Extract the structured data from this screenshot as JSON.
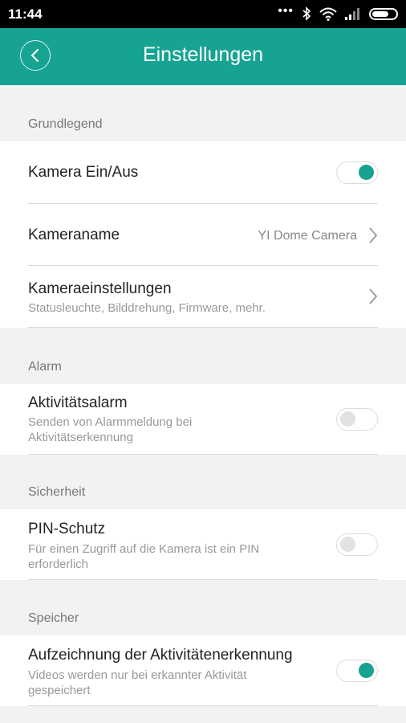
{
  "status_bar": {
    "time": "11:44",
    "icons": [
      "more-dots-icon",
      "bluetooth-icon",
      "wifi-icon",
      "signal-icon",
      "battery-icon"
    ]
  },
  "header": {
    "title": "Einstellungen",
    "back_icon": "chevron-left-icon",
    "color": "#16a392"
  },
  "sections": [
    {
      "label": "Grundlegend",
      "items": [
        {
          "title": "Kamera Ein/Aus",
          "toggle": true
        },
        {
          "title": "Kameraname",
          "value": "YI Dome Camera",
          "icon": "chevron-right-icon"
        },
        {
          "title": "Kameraeinstellungen",
          "subtitle": "Statusleuchte, Bilddrehung, Firmware, mehr.",
          "icon": "chevron-right-icon"
        }
      ]
    },
    {
      "label": "Alarm",
      "items": [
        {
          "title": "Aktivitätsalarm",
          "subtitle": "Senden von Alarmmeldung bei Aktivitätserkennung",
          "toggle": false
        }
      ]
    },
    {
      "label": "Sicherheit",
      "items": [
        {
          "title": "PIN-Schutz",
          "subtitle": "Für einen Zugriff auf die Kamera ist ein PIN erforderlich",
          "toggle": false
        }
      ]
    },
    {
      "label": "Speicher",
      "items": [
        {
          "title": "Aufzeichnung der Aktivitätenerkennung",
          "subtitle": "Videos werden nur bei erkannter Aktivität gespeichert",
          "toggle": true
        }
      ]
    }
  ]
}
